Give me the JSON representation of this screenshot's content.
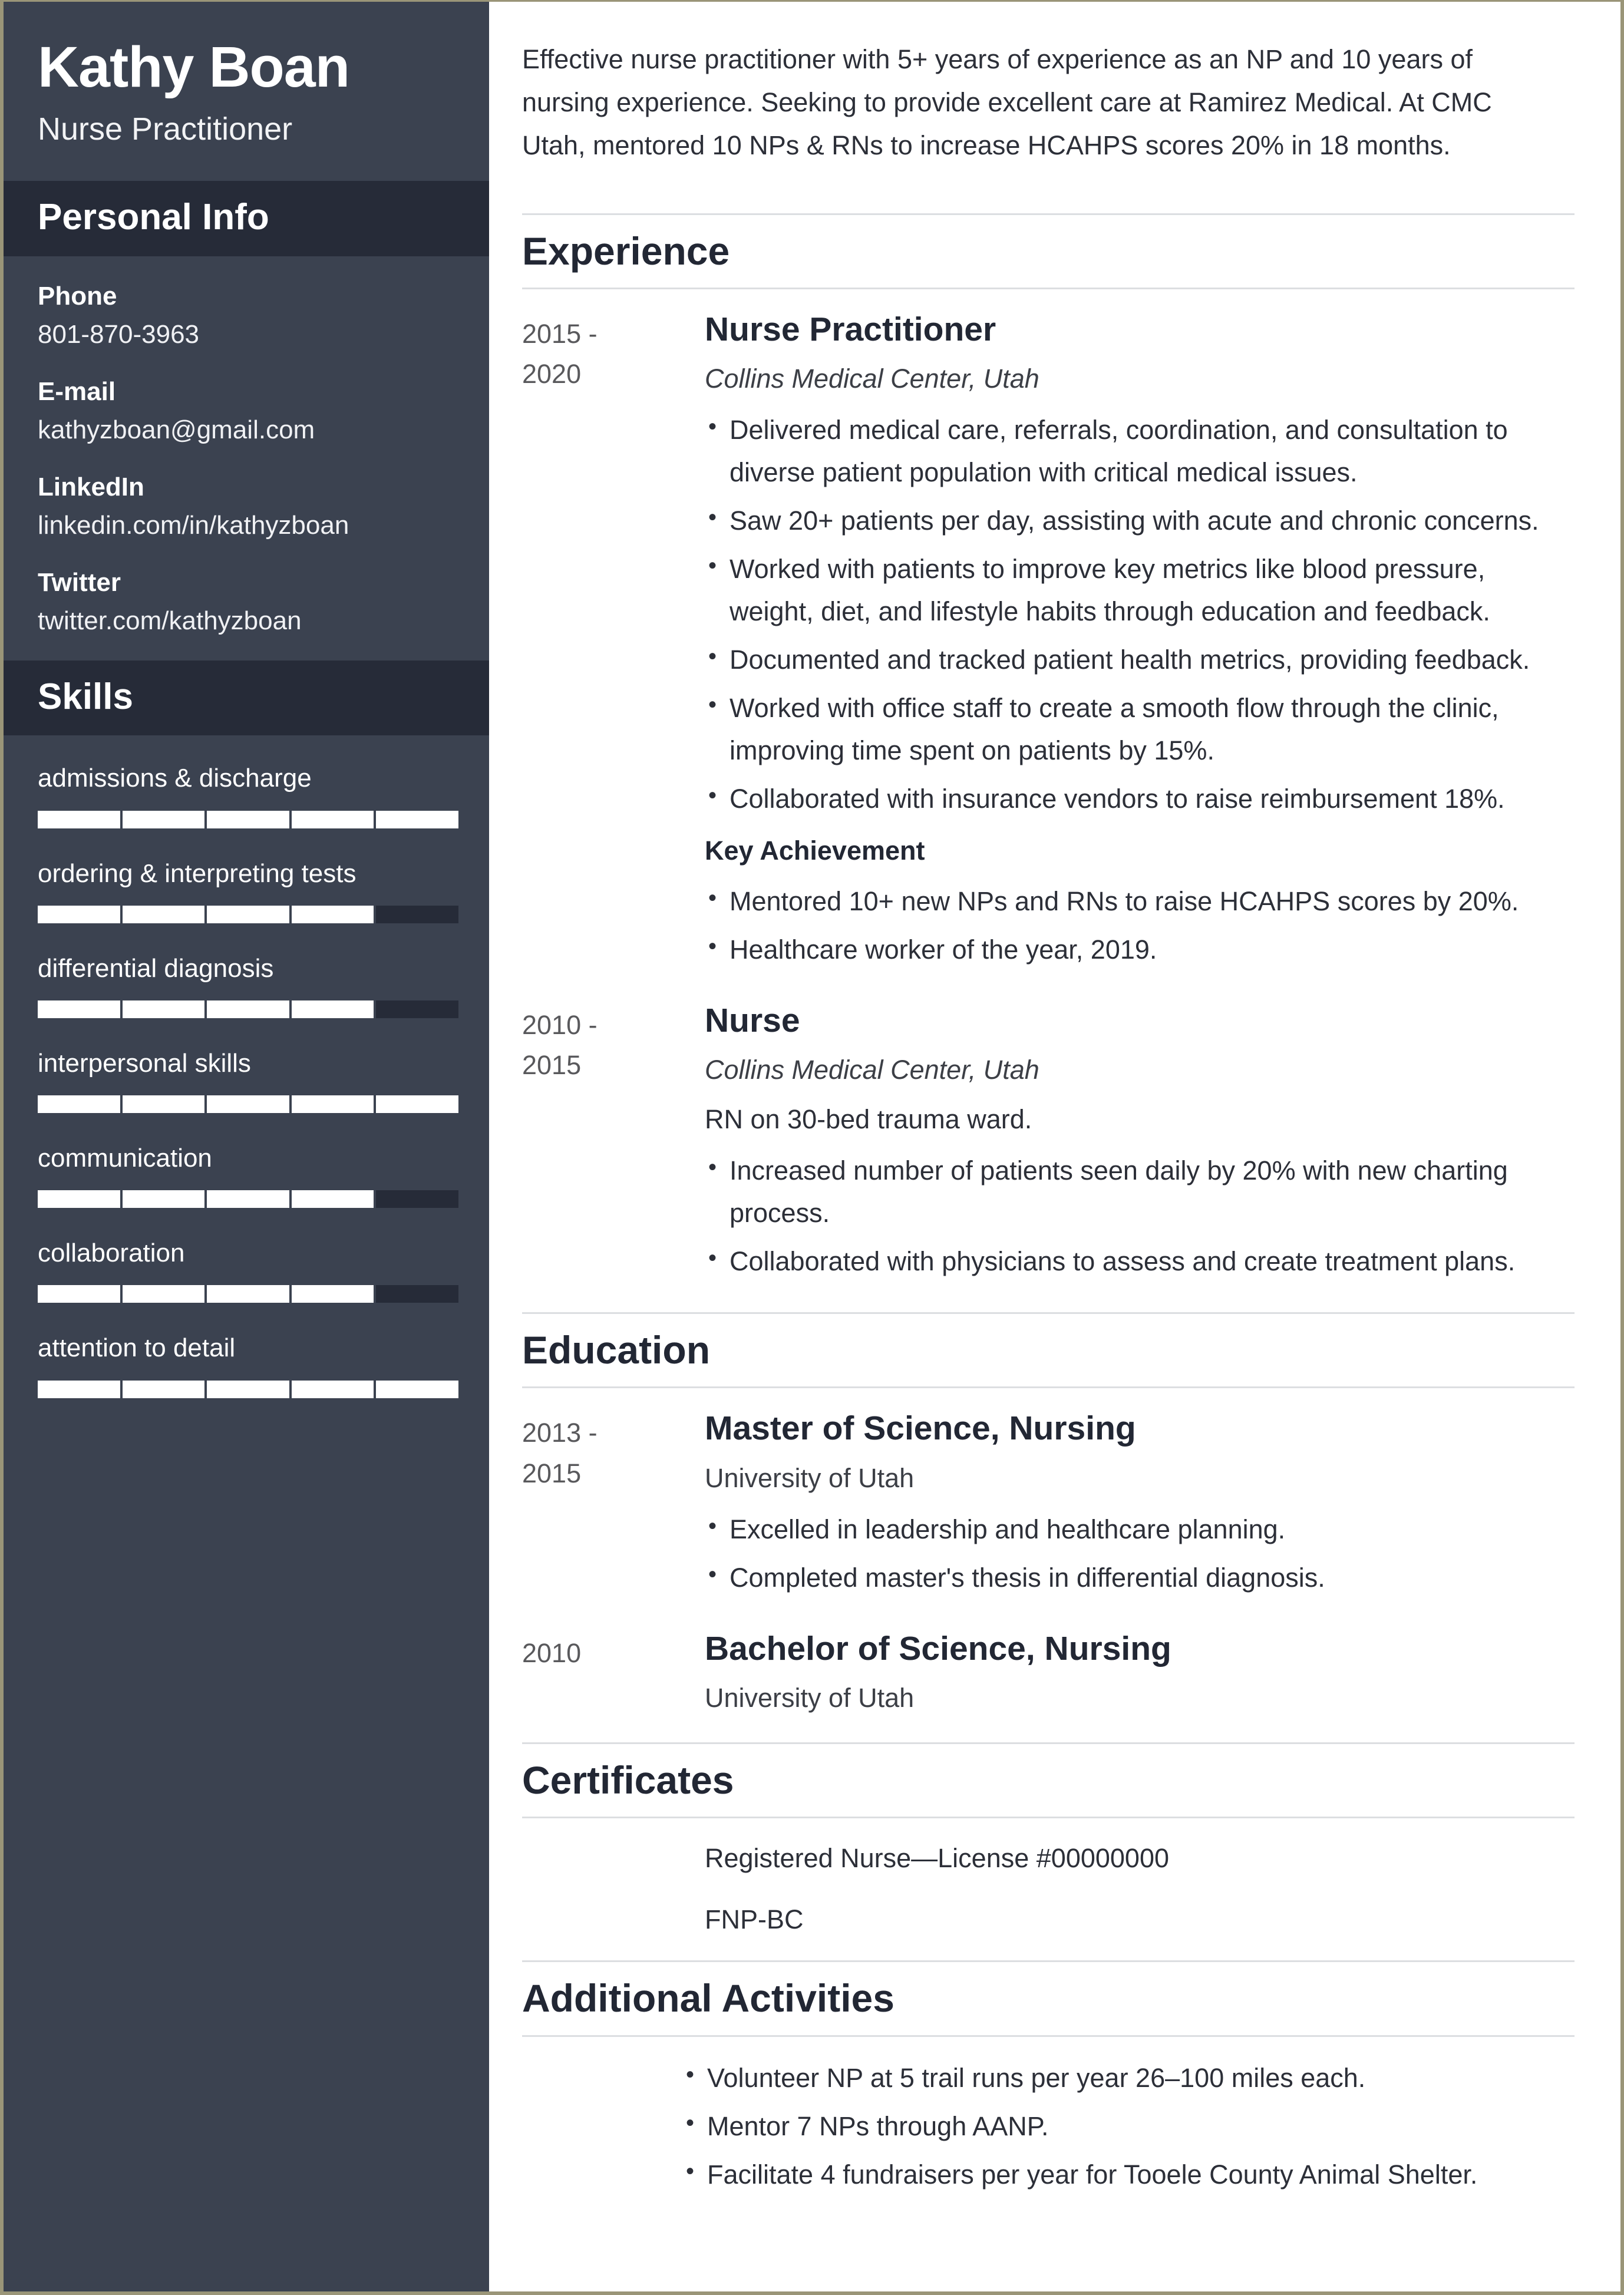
{
  "sidebar": {
    "name": "Kathy Boan",
    "role": "Nurse Practitioner",
    "personal_info": {
      "heading": "Personal Info",
      "items": [
        {
          "label": "Phone",
          "value": "801-870-3963"
        },
        {
          "label": "E-mail",
          "value": "kathyzboan@gmail.com"
        },
        {
          "label": "LinkedIn",
          "value": "linkedin.com/in/kathyzboan"
        },
        {
          "label": "Twitter",
          "value": "twitter.com/kathyzboan"
        }
      ]
    },
    "skills": {
      "heading": "Skills",
      "items": [
        {
          "name": "admissions & discharge",
          "level": 5,
          "max": 5
        },
        {
          "name": "ordering & interpreting tests",
          "level": 4,
          "max": 5
        },
        {
          "name": "differential diagnosis",
          "level": 4,
          "max": 5
        },
        {
          "name": "interpersonal skills",
          "level": 5,
          "max": 5
        },
        {
          "name": "communication",
          "level": 4,
          "max": 5
        },
        {
          "name": "collaboration",
          "level": 4,
          "max": 5
        },
        {
          "name": "attention to detail",
          "level": 5,
          "max": 5
        }
      ]
    }
  },
  "main": {
    "summary": "Effective nurse practitioner with 5+ years of experience as an NP and 10 years of nursing experience. Seeking to provide excellent care at Ramirez Medical. At CMC Utah, mentored 10 NPs & RNs to increase HCAHPS scores 20% in 18 months.",
    "experience": {
      "heading": "Experience",
      "entries": [
        {
          "date": "2015 -\n2020",
          "title": "Nurse Practitioner",
          "subtitle": "Collins Medical Center, Utah",
          "bullets": [
            "Delivered medical care, referrals, coordination, and consultation to diverse patient population with critical medical issues.",
            "Saw 20+ patients per day, assisting with acute and chronic concerns.",
            "Worked with patients to improve key metrics like blood pressure, weight, diet, and lifestyle habits through education and feedback.",
            "Documented and tracked patient health metrics, providing feedback.",
            "Worked with office staff to create a smooth flow through the clinic, improving time spent on patients by 15%.",
            "Collaborated with insurance vendors to raise reimbursement 18%."
          ],
          "achievement_label": "Key Achievement",
          "achievements": [
            "Mentored 10+ new NPs and RNs to raise HCAHPS scores by 20%.",
            "Healthcare worker of the year, 2019."
          ]
        },
        {
          "date": "2010 -\n2015",
          "title": "Nurse",
          "subtitle": "Collins Medical Center, Utah",
          "description": "RN on 30-bed trauma ward.",
          "bullets": [
            "Increased number of patients seen daily by 20% with new charting process.",
            "Collaborated with physicians to assess and create treatment plans."
          ]
        }
      ]
    },
    "education": {
      "heading": "Education",
      "entries": [
        {
          "date": "2013 -\n2015",
          "title": "Master of Science, Nursing",
          "subtitle": "University of Utah",
          "bullets": [
            "Excelled in leadership and healthcare planning.",
            "Completed master's thesis in differential diagnosis."
          ]
        },
        {
          "date": "2010",
          "title": "Bachelor of Science, Nursing",
          "subtitle": "University of Utah",
          "bullets": []
        }
      ]
    },
    "certificates": {
      "heading": "Certificates",
      "items": [
        "Registered Nurse—License #00000000",
        "FNP-BC"
      ]
    },
    "activities": {
      "heading": "Additional Activities",
      "items": [
        "Volunteer NP at 5 trail runs per year 26–100 miles each.",
        "Mentor 7 NPs through AANP.",
        "Facilitate 4 fundraisers per year for Tooele County Animal Shelter."
      ]
    }
  },
  "colors": {
    "sidebar_bg": "#3b4250",
    "sidebar_band_bg": "#262b38",
    "heading_navy": "#222734",
    "page_border": "#9a9578",
    "rule_gray": "#dcdee1",
    "skill_fill": "#ffffff"
  }
}
